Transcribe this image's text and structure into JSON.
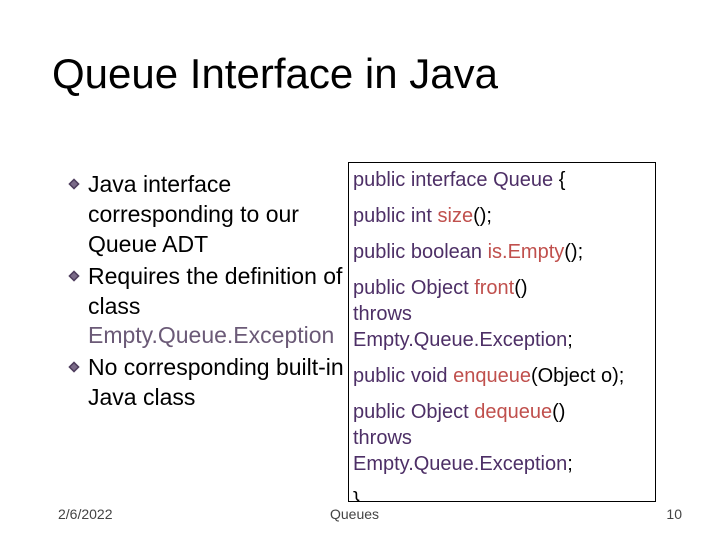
{
  "title": "Queue Interface in Java",
  "bullets": [
    {
      "pre": "Java interface corresponding to our Queue ADT",
      "cls": ""
    },
    {
      "pre": "Requires the definition of class ",
      "cls": "Empty.Queue.Exception"
    },
    {
      "pre": "No corresponding built-in Java class",
      "cls": ""
    }
  ],
  "code": {
    "decl": {
      "kw1": "public",
      "kw2": "interface",
      "name": "Queue",
      "br": " {"
    },
    "m1": {
      "ind": "   ",
      "kw": "public",
      "ret": "int",
      "name": "size",
      "tail": "();"
    },
    "m2": {
      "ind": "   ",
      "kw": "public",
      "ret": "boolean",
      "name": "is.Empty",
      "tail": "();"
    },
    "m3": {
      "ind": "   ",
      "kw": "public",
      "ret": "Object",
      "name": "front",
      "tail": "()",
      "throws_ind": "         ",
      "throws_kw": "throws",
      "exc": "Empty.Queue.Exception",
      "sc": ";"
    },
    "m4": {
      "ind": "   ",
      "kw": "public",
      "ret": "void",
      "name": "enqueue",
      "args": "(Object o);"
    },
    "m5": {
      "ind": "   ",
      "kw": "public",
      "ret": "Object",
      "name": "dequeue",
      "tail": "()",
      "throws_ind": "         ",
      "throws_kw": "throws",
      "exc": "Empty.Queue.Exception",
      "sc": ";"
    },
    "close": "}"
  },
  "footer": {
    "date": "2/6/2022",
    "center": "Queues",
    "page": "10"
  }
}
